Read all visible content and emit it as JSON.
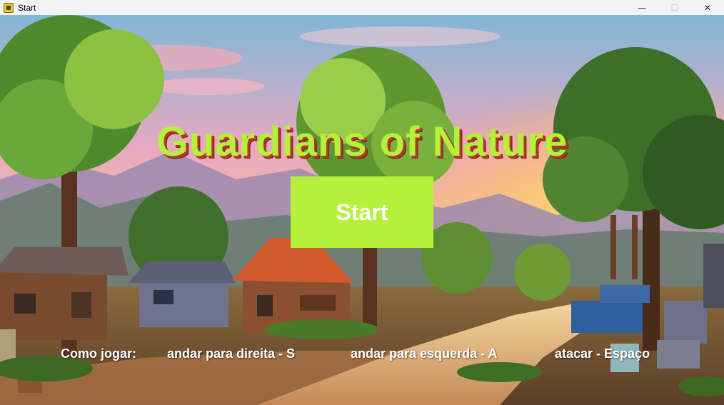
{
  "window": {
    "title": "Start",
    "minimize_glyph": "—",
    "maximize_glyph": "☐",
    "close_glyph": "✕"
  },
  "game": {
    "title": "Guardians of Nature",
    "start_label": "Start"
  },
  "help": {
    "label": "Como jogar:",
    "controls": [
      "andar para direita - S",
      "andar para esquerda - A",
      "atacar - Espaço"
    ]
  },
  "colors": {
    "title": "#b5f03a",
    "title_shadow": "#b0372c",
    "button": "#b5f03a",
    "button_text": "#ffffff"
  }
}
